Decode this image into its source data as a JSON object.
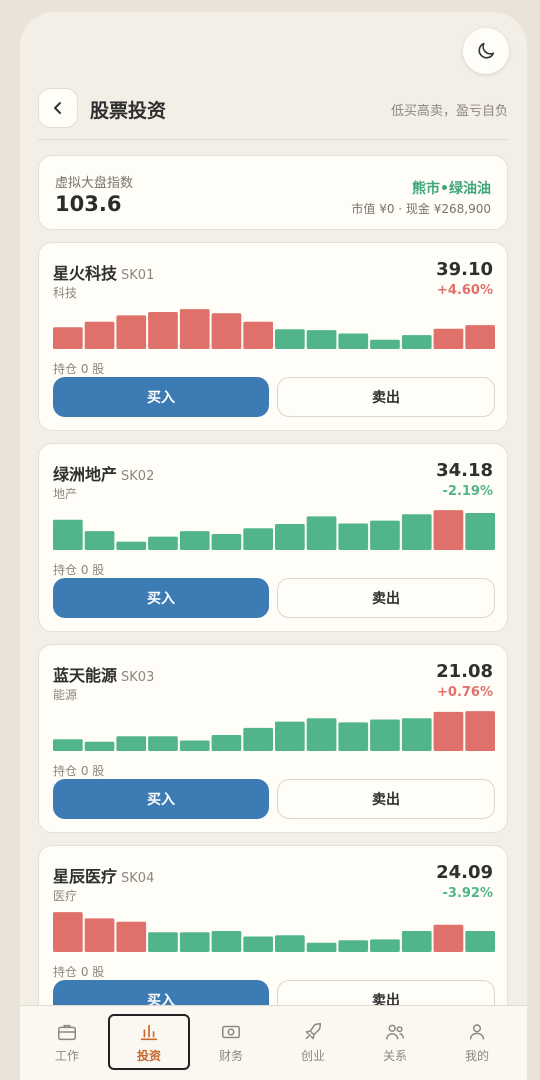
{
  "header": {
    "title": "股票投资",
    "hint": "低买高卖，盈亏自负"
  },
  "index": {
    "label": "虚拟大盘指数",
    "value": "103.6",
    "market_state": "熊市•绿油油",
    "summary": "市值 ¥0 · 现金 ¥268,900"
  },
  "colors": {
    "up": "#e0706a",
    "down": "#52b58a",
    "accent": "#3d7bb4",
    "active_tab": "#c7682d"
  },
  "stocks": [
    {
      "name": "星火科技",
      "code": "SK01",
      "sector": "科技",
      "price": "39.10",
      "change": "+4.60%",
      "direction": "up",
      "holding": "持仓 0 股",
      "buy_label": "买入",
      "sell_label": "卖出",
      "bars": [
        {
          "level": 0.52,
          "dir": "up"
        },
        {
          "level": 0.65,
          "dir": "up"
        },
        {
          "level": 0.8,
          "dir": "up"
        },
        {
          "level": 0.88,
          "dir": "up"
        },
        {
          "level": 0.95,
          "dir": "up"
        },
        {
          "level": 0.85,
          "dir": "up"
        },
        {
          "level": 0.65,
          "dir": "up"
        },
        {
          "level": 0.47,
          "dir": "down"
        },
        {
          "level": 0.45,
          "dir": "down"
        },
        {
          "level": 0.37,
          "dir": "down"
        },
        {
          "level": 0.22,
          "dir": "down"
        },
        {
          "level": 0.33,
          "dir": "down"
        },
        {
          "level": 0.48,
          "dir": "up"
        },
        {
          "level": 0.57,
          "dir": "up"
        }
      ]
    },
    {
      "name": "绿洲地产",
      "code": "SK02",
      "sector": "地产",
      "price": "34.18",
      "change": "-2.19%",
      "direction": "down",
      "holding": "持仓 0 股",
      "buy_label": "买入",
      "sell_label": "卖出",
      "bars": [
        {
          "level": 0.72,
          "dir": "down"
        },
        {
          "level": 0.45,
          "dir": "down"
        },
        {
          "level": 0.2,
          "dir": "down"
        },
        {
          "level": 0.32,
          "dir": "down"
        },
        {
          "level": 0.45,
          "dir": "down"
        },
        {
          "level": 0.38,
          "dir": "down"
        },
        {
          "level": 0.52,
          "dir": "down"
        },
        {
          "level": 0.62,
          "dir": "down"
        },
        {
          "level": 0.8,
          "dir": "down"
        },
        {
          "level": 0.63,
          "dir": "down"
        },
        {
          "level": 0.7,
          "dir": "down"
        },
        {
          "level": 0.85,
          "dir": "down"
        },
        {
          "level": 0.95,
          "dir": "up"
        },
        {
          "level": 0.88,
          "dir": "down"
        }
      ]
    },
    {
      "name": "蓝天能源",
      "code": "SK03",
      "sector": "能源",
      "price": "21.08",
      "change": "+0.76%",
      "direction": "up",
      "holding": "持仓 0 股",
      "buy_label": "买入",
      "sell_label": "卖出",
      "bars": [
        {
          "level": 0.28,
          "dir": "down"
        },
        {
          "level": 0.22,
          "dir": "down"
        },
        {
          "level": 0.35,
          "dir": "down"
        },
        {
          "level": 0.35,
          "dir": "down"
        },
        {
          "level": 0.25,
          "dir": "down"
        },
        {
          "level": 0.38,
          "dir": "down"
        },
        {
          "level": 0.55,
          "dir": "down"
        },
        {
          "level": 0.7,
          "dir": "down"
        },
        {
          "level": 0.78,
          "dir": "down"
        },
        {
          "level": 0.68,
          "dir": "down"
        },
        {
          "level": 0.75,
          "dir": "down"
        },
        {
          "level": 0.78,
          "dir": "down"
        },
        {
          "level": 0.93,
          "dir": "up"
        },
        {
          "level": 0.95,
          "dir": "up"
        }
      ]
    },
    {
      "name": "星辰医疗",
      "code": "SK04",
      "sector": "医疗",
      "price": "24.09",
      "change": "-3.92%",
      "direction": "down",
      "holding": "持仓 0 股",
      "buy_label": "买入",
      "sell_label": "卖出",
      "bars": [
        {
          "level": 0.95,
          "dir": "up"
        },
        {
          "level": 0.8,
          "dir": "up"
        },
        {
          "level": 0.72,
          "dir": "up"
        },
        {
          "level": 0.47,
          "dir": "down"
        },
        {
          "level": 0.47,
          "dir": "down"
        },
        {
          "level": 0.5,
          "dir": "down"
        },
        {
          "level": 0.37,
          "dir": "down"
        },
        {
          "level": 0.4,
          "dir": "down"
        },
        {
          "level": 0.22,
          "dir": "down"
        },
        {
          "level": 0.28,
          "dir": "down"
        },
        {
          "level": 0.3,
          "dir": "down"
        },
        {
          "level": 0.5,
          "dir": "down"
        },
        {
          "level": 0.65,
          "dir": "up"
        },
        {
          "level": 0.5,
          "dir": "down"
        }
      ]
    }
  ],
  "tabs": [
    {
      "label": "工作",
      "icon": "briefcase-icon",
      "active": false
    },
    {
      "label": "投资",
      "icon": "chart-icon",
      "active": true
    },
    {
      "label": "财务",
      "icon": "banknote-icon",
      "active": false
    },
    {
      "label": "创业",
      "icon": "rocket-icon",
      "active": false
    },
    {
      "label": "关系",
      "icon": "people-icon",
      "active": false
    },
    {
      "label": "我的",
      "icon": "person-icon",
      "active": false
    }
  ]
}
